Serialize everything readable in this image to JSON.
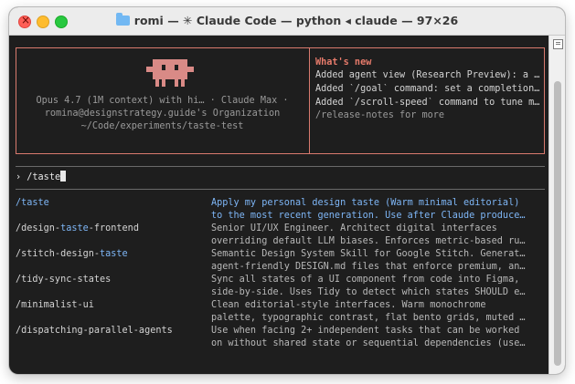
{
  "window": {
    "title": "romi — ✳ Claude Code — python ◂ claude — 97×26"
  },
  "banner": {
    "model_line": "Opus 4.7 (1M context) with hi… · Claude Max ·",
    "account_line": "romina@designstrategy.guide's Organization",
    "path_line": "~/Code/experiments/taste-test",
    "whats_new_title": "What's new",
    "whats_new_items": [
      "Added agent view (Research Preview): a …",
      "Added `/goal` command: set a completion…",
      "Added `/scroll-speed` command to tune m…"
    ],
    "release_notes": "/release-notes for more"
  },
  "prompt": {
    "symbol": "›",
    "input": "/taste"
  },
  "suggestions": [
    {
      "pre": "/taste",
      "hl": "",
      "post": "",
      "line1": "Apply my personal design taste (Warm minimal editorial)",
      "line2": "to the most recent generation. Use after Claude produces…"
    },
    {
      "pre": "/design-",
      "hl": "taste",
      "post": "-frontend",
      "line1": "Senior UI/UX Engineer. Architect digital interfaces",
      "line2": "overriding default LLM biases. Enforces metric-based rul…"
    },
    {
      "pre": "/stitch-design-",
      "hl": "taste",
      "post": "",
      "line1": "Semantic Design System Skill for Google Stitch. Generates",
      "line2": "agent-friendly DESIGN.md files that enforce premium, ant…"
    },
    {
      "pre": "/tidy-sync-states",
      "hl": "",
      "post": "",
      "line1": "Sync all states of a UI component from code into Figma,",
      "line2": "side-by-side. Uses Tidy to detect which states SHOULD ex…"
    },
    {
      "pre": "/minimalist-ui",
      "hl": "",
      "post": "",
      "line1": "Clean editorial-style interfaces. Warm monochrome",
      "line2": "palette, typographic contrast, flat bento grids, muted p…"
    },
    {
      "pre": "/dispatching-parallel-agents",
      "hl": "",
      "post": "",
      "line1": "Use when facing 2+ independent tasks that can be worked",
      "line2": "on without shared state or sequential dependencies (user)"
    }
  ],
  "colors": {
    "accent_salmon": "#d97a6e",
    "selection_blue": "#7eb6f6",
    "terminal_bg": "#1e1e1e"
  }
}
